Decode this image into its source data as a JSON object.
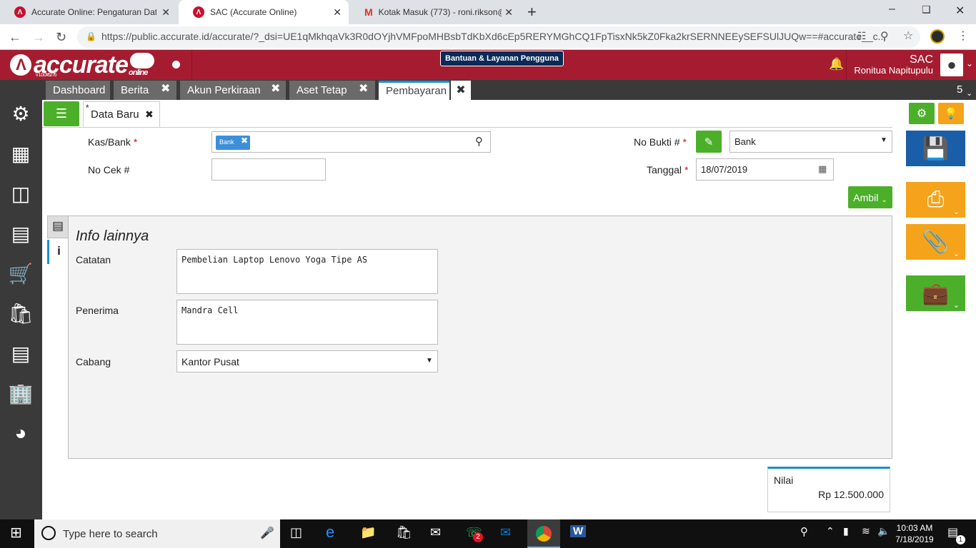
{
  "browser": {
    "tabs": [
      {
        "title": "Accurate Online: Pengaturan Dat",
        "icon": "accurate-icon"
      },
      {
        "title": "SAC (Accurate Online)",
        "icon": "accurate-icon"
      },
      {
        "title": "Kotak Masuk (773) - roni.rikson@",
        "icon": "gmail-icon"
      }
    ],
    "url": "https://public.accurate.id/accurate/?_dsi=UE1qMkhqaVk3R0dOYjhVMFpoMHBsbTdKbXd6cEp5RERYMGhCQ1FpTisxNk5kZ0Fka2krSERNNEEySEFSUlJUQw==#accurate__c..."
  },
  "app": {
    "logo_text": "accurate",
    "logo_sub": "online",
    "version": "v 1.0.0#6276",
    "help_button": "Bantuan & Layanan Pengguna",
    "company": "SAC",
    "user_name": "Ronitua Napitupulu",
    "tab_count": "5"
  },
  "module_tabs": [
    {
      "label": "Dashboard"
    },
    {
      "label": "Berita"
    },
    {
      "label": "Akun Perkiraan"
    },
    {
      "label": "Aset Tetap"
    },
    {
      "label": "Pembayaran"
    }
  ],
  "form": {
    "subtab": "Data Baru",
    "kas_bank_label": "Kas/Bank",
    "kas_bank_tag": "Bank",
    "no_cek_label": "No Cek #",
    "no_cek_value": "",
    "no_bukti_label": "No Bukti #",
    "no_bukti_type": "Bank",
    "tanggal_label": "Tanggal",
    "tanggal_value": "18/07/2019",
    "ambil_button": "Ambil",
    "panel_title": "Info lainnya",
    "catatan_label": "Catatan",
    "catatan_value": "Pembelian Laptop Lenovo Yoga Tipe AS",
    "penerima_label": "Penerima",
    "penerima_value": "Mandra Cell",
    "cabang_label": "Cabang",
    "cabang_value": "Kantor Pusat",
    "nilai_label": "Nilai",
    "nilai_value": "Rp 12.500.000"
  },
  "taskbar": {
    "search_placeholder": "Type here to search",
    "time": "10:03 AM",
    "date": "7/18/2019",
    "whatsapp_badge": "2",
    "notification_count": "1"
  },
  "colors": {
    "brand_red": "#a51c30",
    "green": "#4caf2a",
    "blue": "#1a5ea8",
    "orange": "#f5a31a"
  }
}
